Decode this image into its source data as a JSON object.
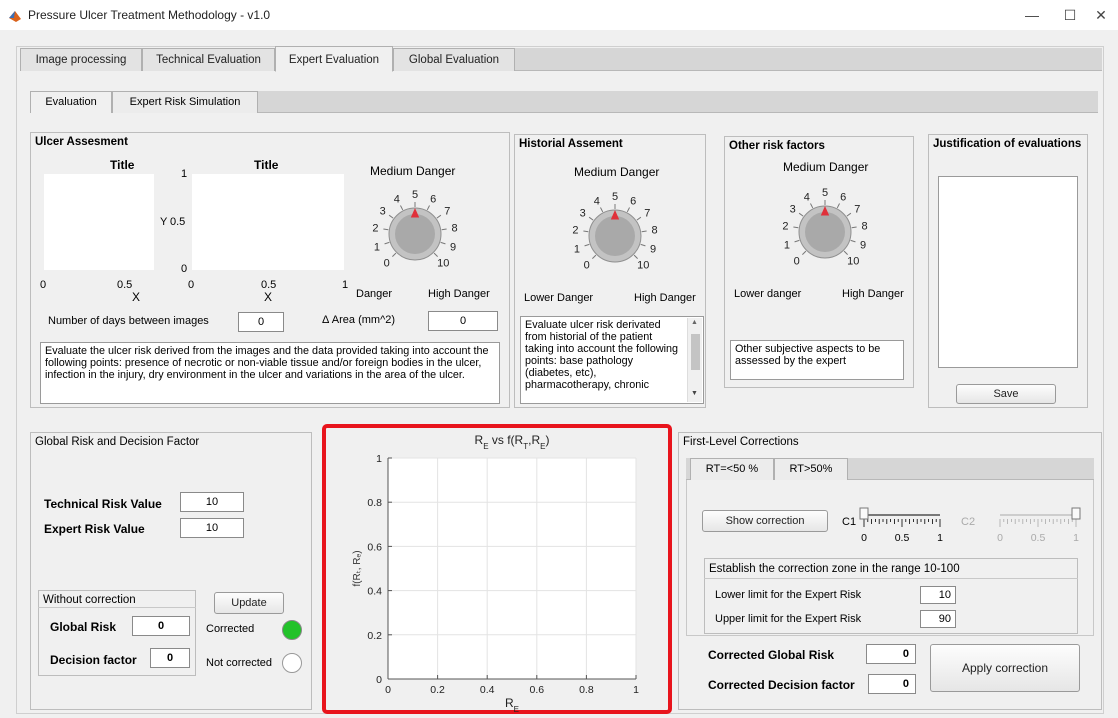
{
  "window": {
    "title": "Pressure Ulcer Treatment Methodology - v1.0",
    "minimize": "—",
    "maximize": "☐",
    "close": "✕"
  },
  "tabs": [
    "Image processing",
    "Technical Evaluation",
    "Expert Evaluation",
    "Global Evaluation"
  ],
  "subtabs": [
    "Evaluation",
    "Expert Risk Simulation"
  ],
  "ulcer": {
    "title": "Ulcer Assesment",
    "plot1": {
      "title": "Title",
      "xlabel": "X",
      "ylabel": "",
      "xticks": [
        "0",
        "0.5",
        ""
      ],
      "yticks": [
        "",
        "",
        ""
      ]
    },
    "plot2": {
      "title": "Title",
      "xlabel": "X",
      "ylabel": "Y",
      "xticks": [
        "0",
        "0.5",
        "1"
      ],
      "yticks": [
        "0",
        "0.5",
        "1"
      ]
    },
    "knob": {
      "title": "Medium Danger",
      "low": "Danger",
      "high": "High Danger",
      "labels": [
        "0",
        "1",
        "2",
        "3",
        "4",
        "5",
        "6",
        "7",
        "8",
        "9",
        "10"
      ],
      "value": 5
    },
    "days_label": "Number of days between images",
    "days_value": "0",
    "area_label": "Δ Area (mm^2)",
    "area_value": "0",
    "description": "Evaluate the ulcer risk derived from the images and the data provided taking into account the following points: presence of necrotic or non-viable tissue and/or foreign bodies in the ulcer, infection in the injury, dry environment in the ulcer and  variations in the area of the ulcer."
  },
  "historial": {
    "title": "Historial Assement",
    "knob": {
      "title": "Medium Danger",
      "low": "Lower Danger",
      "high": "High Danger",
      "labels": [
        "0",
        "1",
        "2",
        "3",
        "4",
        "5",
        "6",
        "7",
        "8",
        "9",
        "10"
      ],
      "value": 5
    },
    "description": "Evaluate ulcer risk derivated from historial of the patient taking into account the following points: base pathology (diabetes, etc), pharmacotherapy, chronic"
  },
  "other": {
    "title": "Other risk factors",
    "knob": {
      "title": "Medium Danger",
      "low": "Lower danger",
      "high": "High Danger",
      "labels": [
        "0",
        "1",
        "2",
        "3",
        "4",
        "5",
        "6",
        "7",
        "8",
        "9",
        "10"
      ],
      "value": 5
    },
    "description": "Other subjective aspects to be assessed by the expert"
  },
  "justification": {
    "title": "Justification of evaluations",
    "save": "Save"
  },
  "global": {
    "title": "Global Risk and Decision Factor",
    "technical_label": "Technical Risk Value",
    "technical_value": "10",
    "expert_label": "Expert Risk Value",
    "expert_value": "10",
    "without_title": "Without correction",
    "global_label": "Global Risk",
    "global_value": "0",
    "decision_label": "Decision factor",
    "decision_value": "0",
    "update": "Update",
    "corrected": "Corrected",
    "not_corrected": "Not corrected",
    "corrected_color": "#22c22a"
  },
  "chart_data": {
    "type": "line",
    "title_parts": [
      "R",
      "E",
      " vs  f(R",
      "T",
      ",R",
      "E",
      ")"
    ],
    "xlabel_parts": [
      "R",
      "E"
    ],
    "ylabel": "f(Rₜ, Rₑ)",
    "xlim": [
      0,
      1
    ],
    "ylim": [
      0,
      1
    ],
    "xticks": [
      "0",
      "0.2",
      "0.4",
      "0.6",
      "0.8",
      "1"
    ],
    "yticks": [
      "0",
      "0.2",
      "0.4",
      "0.6",
      "0.8",
      "1"
    ],
    "grid": true,
    "series": [],
    "highlight_color": "#e8141c"
  },
  "corrections": {
    "title": "First-Level Corrections",
    "tabs": [
      "RT=<50 %",
      "RT>50%"
    ],
    "show": "Show correction",
    "c1_label": "C1",
    "c2_label": "C2",
    "slider_ticks": [
      "0",
      "0.5",
      "1"
    ],
    "c1_value": 0,
    "c2_value": 1,
    "zone_title": "Establish the correction zone in the range 10-100",
    "lower_label": "Lower limit for the Expert Risk",
    "lower_value": "10",
    "upper_label": "Upper limit for the Expert Risk",
    "upper_value": "90",
    "cgr_label": "Corrected Global Risk",
    "cgr_value": "0",
    "cdf_label": "Corrected Decision factor",
    "cdf_value": "0",
    "apply": "Apply correction"
  }
}
